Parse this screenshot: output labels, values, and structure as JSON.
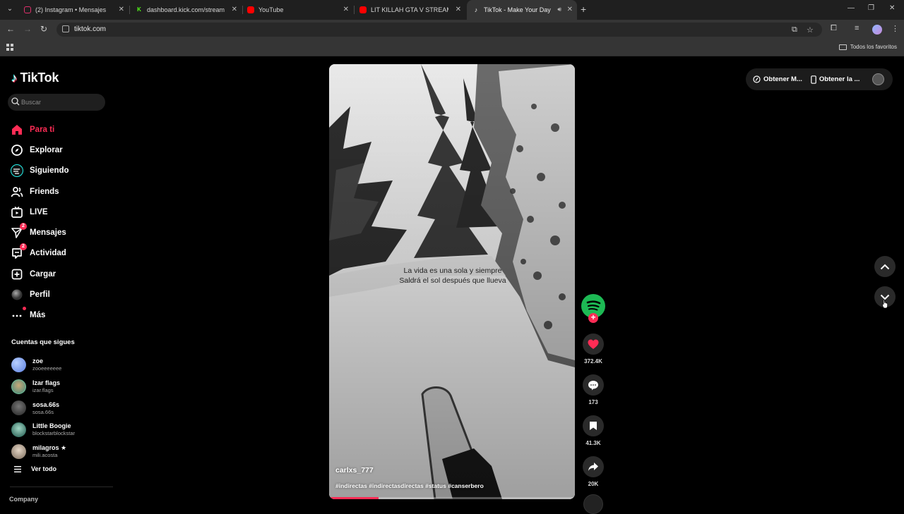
{
  "browser": {
    "tabs": [
      {
        "title": "(2) Instagram • Mensajes",
        "favicon": "instagram-icon",
        "color": "#e1306c"
      },
      {
        "title": "dashboard.kick.com/stream",
        "favicon": "kick-icon",
        "color": "#53fc18"
      },
      {
        "title": "YouTube",
        "favicon": "youtube-icon",
        "color": "#ff0000"
      },
      {
        "title": "LIT KILLAH GTA V STREAM #1 -",
        "favicon": "youtube-icon",
        "color": "#ff0000"
      },
      {
        "title": "TikTok - Make Your Day",
        "favicon": "tiktok-icon",
        "color": "#ffffff",
        "active": true
      }
    ],
    "url": "tiktok.com",
    "bookmarks_all": "Todos los favoritos"
  },
  "tiktok": {
    "logo": "TikTok",
    "search_placeholder": "Buscar",
    "nav": [
      {
        "label": "Para ti",
        "icon": "home-icon",
        "active": true
      },
      {
        "label": "Explorar",
        "icon": "compass-icon"
      },
      {
        "label": "Siguiendo",
        "icon": "following-icon"
      },
      {
        "label": "Friends",
        "icon": "friends-icon"
      },
      {
        "label": "LIVE",
        "icon": "live-icon"
      },
      {
        "label": "Mensajes",
        "icon": "messages-icon",
        "badge": "2"
      },
      {
        "label": "Actividad",
        "icon": "activity-icon",
        "badge": "2"
      },
      {
        "label": "Cargar",
        "icon": "upload-icon"
      },
      {
        "label": "Perfil",
        "icon": "profile-icon"
      },
      {
        "label": "Más",
        "icon": "more-icon",
        "dot": true
      }
    ],
    "following_title": "Cuentas que sigues",
    "following": [
      {
        "name": "zoe",
        "handle": "zooeeeeeee",
        "color": "#7aa8ff"
      },
      {
        "name": "Izar flags",
        "handle": "izar.flags",
        "color": "#6fbf9a"
      },
      {
        "name": "sosa.66s",
        "handle": "sosa.66s",
        "color": "#5a5a5a"
      },
      {
        "name": "Little Boogie",
        "handle": "blockstarblockstar",
        "color": "#3f7f6f"
      },
      {
        "name": "milagros ★",
        "handle": "mili.acosta",
        "color": "#b9a99a"
      }
    ],
    "see_all": "Ver todo",
    "company": "Company",
    "video": {
      "caption": "La vida es una sola y siempre Saldrá el sol después que llueva",
      "username": "carlxs_777",
      "hashtags": "#indirectas #indirectasdirectas #status #canserbero",
      "progress": 0.2
    },
    "actions": {
      "likes": "372.4K",
      "comments": "173",
      "saves": "41.3K",
      "shares": "20K"
    },
    "topright": {
      "coins": "Obtener M...",
      "app": "Obtener la ..."
    },
    "colors": {
      "accent": "#fe2c55",
      "spotify": "#1db954"
    }
  }
}
